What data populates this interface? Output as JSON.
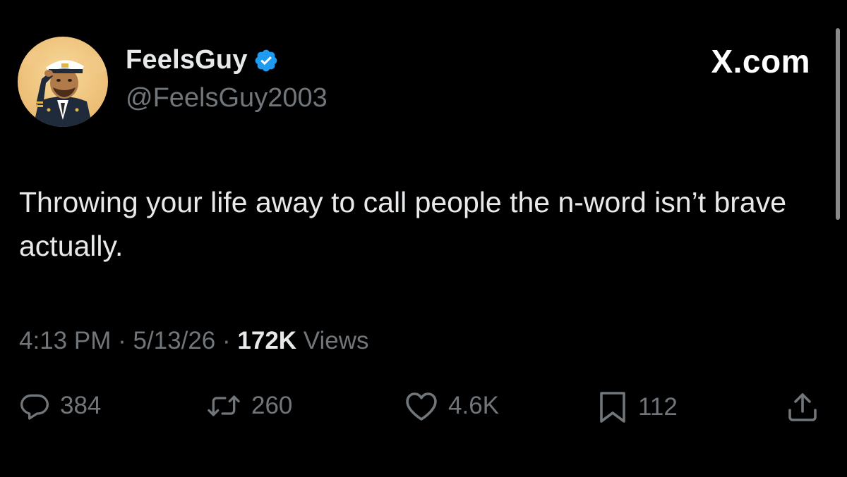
{
  "tweet": {
    "display_name": "FeelsGuy",
    "handle": "@FeelsGuy2003",
    "verified": true,
    "site_mark": "X.com",
    "text": "Throwing your life away to call people the n-word isn’t brave actually.",
    "time": "4:13 PM",
    "date": "5/13/26",
    "separator": "·",
    "views_count": "172K",
    "views_label": "Views"
  },
  "actions": {
    "replies": "384",
    "reposts": "260",
    "likes": "4.6K",
    "bookmarks": "112"
  },
  "icons": {
    "reply": "reply-icon",
    "repost": "repost-icon",
    "like": "heart-icon",
    "bookmark": "bookmark-icon",
    "share": "share-icon",
    "verified": "verified-badge-icon"
  },
  "colors": {
    "background": "#000000",
    "text_primary": "#e7e9ea",
    "text_secondary": "#71767b",
    "verified_blue": "#1d9bf0"
  }
}
